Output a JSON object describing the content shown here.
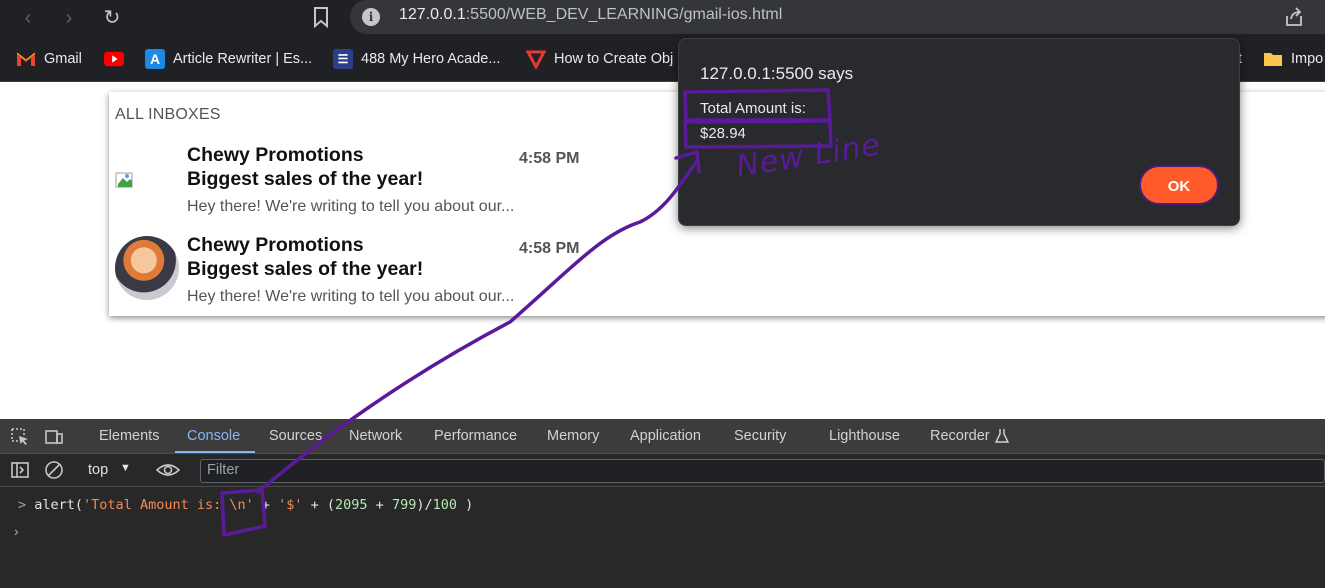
{
  "browser": {
    "url_host": "127.0.0.1",
    "url_rest": ":5500/WEB_DEV_LEARNING/gmail-ios.html"
  },
  "bookmarks": [
    {
      "label": "Gmail",
      "icon": "gmail-icon"
    },
    {
      "label": "",
      "icon": "youtube-icon"
    },
    {
      "label": "Article Rewriter | Es...",
      "icon": "article-rewriter-icon"
    },
    {
      "label": "488 My Hero Acade...",
      "icon": "manga-icon"
    },
    {
      "label": "How to Create Obj",
      "icon": "vivaldi-icon"
    },
    {
      "label": "t",
      "icon": ""
    },
    {
      "label": "Impo",
      "icon": "folder-icon"
    }
  ],
  "inbox": {
    "title": "ALL INBOXES",
    "emails": [
      {
        "sender": "Chewy Promotions",
        "subject": "Biggest sales of the year!",
        "preview": "Hey there! We're writing to tell you about our...",
        "time": "4:58 PM"
      },
      {
        "sender": "Chewy Promotions",
        "subject": "Biggest sales of the year!",
        "preview": "Hey there! We're writing to tell you about our...",
        "time": "4:58 PM"
      }
    ]
  },
  "dialog": {
    "origin": "127.0.0.1:5500 says",
    "line1": "Total Amount is:",
    "line2": "$28.94",
    "ok_label": "OK"
  },
  "devtools": {
    "tabs": [
      "Elements",
      "Console",
      "Sources",
      "Network",
      "Performance",
      "Memory",
      "Application",
      "Security",
      "Lighthouse",
      "Recorder"
    ],
    "active_tab": "Console",
    "context": "top",
    "filter_placeholder": "Filter",
    "console": {
      "fn": "alert(",
      "str1": "'Total Amount is: \\n'",
      "plus1": " + ",
      "str2": "'$'",
      "plus2": " + (",
      "n1": "2095",
      "plus3": " + ",
      "n2": "799",
      "div": ")/",
      "n3": "100",
      "close": " )"
    }
  },
  "annotation": {
    "text": "New Line",
    "color": "#5b1a9a"
  },
  "colors": {
    "ok_button": "#ff5a2a",
    "devtools_active": "#8ab4f8",
    "console_string": "#f28b54",
    "console_number": "#b6e6b4"
  }
}
